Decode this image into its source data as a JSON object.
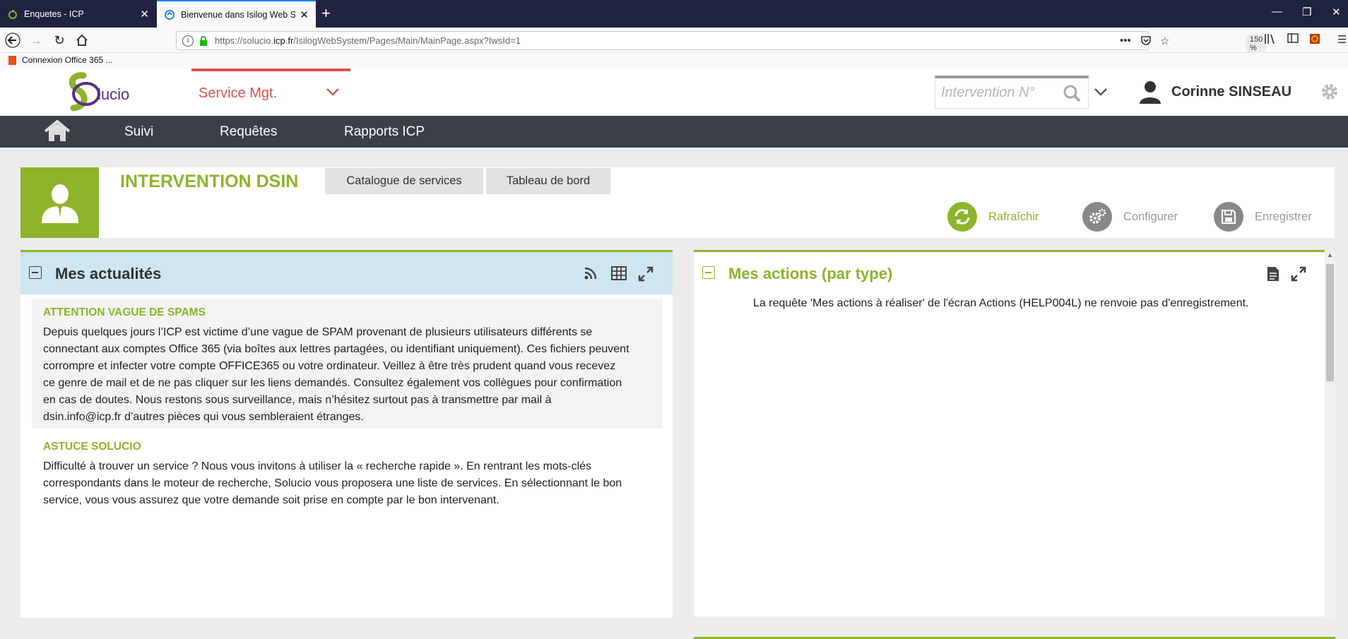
{
  "browser": {
    "tabs": [
      {
        "title": "Enquetes - ICP",
        "active": false
      },
      {
        "title": "Bienvenue dans Isilog Web Syst",
        "active": true
      }
    ],
    "url_prefix": "https://solucio.",
    "url_domain": "icp.fr",
    "url_path": "/IsilogWebSystem/Pages/Main/MainPage.aspx?IwsId=1",
    "zoom": "150 %",
    "bookmark": "Connexion Office 365 ..."
  },
  "app": {
    "logo_text": "lucio",
    "service_label": "Service Mgt.",
    "search_placeholder": "Intervention N°",
    "user_name": "Corinne SINSEAU",
    "menu": [
      "Suivi",
      "Requêtes",
      "Rapports ICP"
    ]
  },
  "dashboard": {
    "title": "INTERVENTION DSIN",
    "tabs": [
      "Catalogue de services",
      "Tableau de bord"
    ],
    "actions": {
      "refresh": "Rafraîchir",
      "configure": "Configurer",
      "save": "Enregistrer"
    }
  },
  "left_panel": {
    "title": "Mes actualités",
    "news": [
      {
        "title": "ATTENTION VAGUE DE SPAMS",
        "lines": [
          "Depuis quelques jours l’ICP est victime d’une vague de SPAM provenant de plusieurs utilisateurs différents se",
          "connectant aux comptes Office 365 (via boîtes aux lettres partagées, ou identifiant uniquement). Ces fichiers peuvent",
          "corrompre et infecter votre compte OFFICE365 ou votre ordinateur. Veillez à être très prudent quand vous recevez",
          "ce genre de mail et de ne pas cliquer sur les liens demandés. Consultez également vos collègues pour confirmation",
          "en cas de doutes. Nous restons sous surveillance, mais n’hésitez surtout pas à transmettre par mail à",
          "dsin.info@icp.fr d’autres pièces qui vous sembleraient étranges."
        ]
      },
      {
        "title": "ASTUCE SOLUCIO",
        "lines": [
          "Difficulté à trouver un service ? Nous vous invitons à utiliser la « recherche rapide ». En rentrant les mots-clés",
          "correspondants dans le moteur de recherche, Solucio vous proposera une liste de services. En sélectionnant le bon",
          "service, vous vous assurez que votre demande soit prise en compte par le bon intervenant."
        ]
      }
    ]
  },
  "right_panel": {
    "title": "Mes actions (par type)",
    "message": "La requête 'Mes actions à réaliser' de l'écran Actions (HELP004L) ne renvoie pas d'enregistrement."
  },
  "colors": {
    "accent_green": "#8db42b",
    "service_red": "#d9534f",
    "menubar": "#3a4046",
    "panel_header_blue": "#cde6f1"
  }
}
